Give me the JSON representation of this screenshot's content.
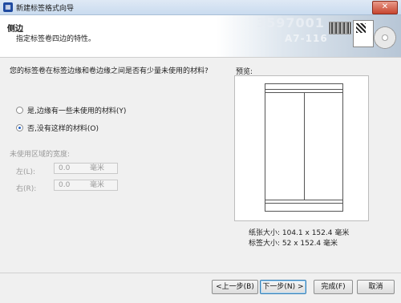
{
  "window": {
    "title": "新建标签格式向导",
    "close_symbol": "✕"
  },
  "header": {
    "title": "侧边",
    "subtitle": "指定标签卷四边的特性。",
    "decor_code_1": "3597001",
    "decor_code_2": "A7-116"
  },
  "question": "您的标签卷在标签边缘和卷边缘之间是否有少量未使用的材料?",
  "options": [
    {
      "label": "是,边缘有一些未使用的材料(Y)",
      "selected": false
    },
    {
      "label": "否,没有这样的材料(O)",
      "selected": true
    }
  ],
  "unused_area": {
    "title": "未使用区域的宽度:",
    "left": {
      "label": "左(L):",
      "value": "0.0",
      "unit": "毫米"
    },
    "right": {
      "label": "右(R):",
      "value": "0.0",
      "unit": "毫米"
    }
  },
  "preview": {
    "label": "预览:",
    "paper_size": "纸张大小: 104.1 x 152.4 毫米",
    "label_size": "标签大小: 52 x 152.4 毫米"
  },
  "buttons": {
    "back": "<上一步(B)",
    "next": "下一步(N) >",
    "finish": "完成(F)",
    "cancel": "取消"
  }
}
